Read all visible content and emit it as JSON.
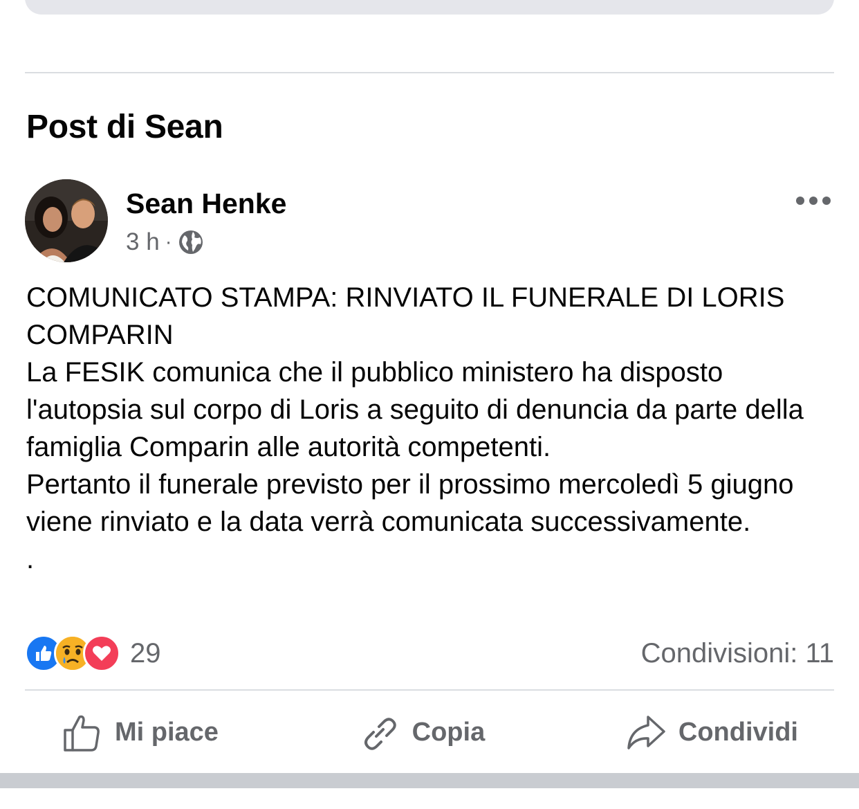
{
  "section": {
    "title": "Post di Sean"
  },
  "post": {
    "author": "Sean Henke",
    "time": "3 h",
    "separator": "·",
    "audience_icon": "globe-icon",
    "more_icon": "more-horizontal-icon",
    "text_lines": [
      "COMUNICATO STAMPA: RINVIATO IL FUNERALE DI LORIS COMPARIN",
      "La FESIK comunica che il pubblico ministero ha disposto l'autopsia sul corpo di Loris a seguito di denuncia da parte della famiglia Comparin alle autorità competenti.",
      "Pertanto il funerale previsto per il prossimo mercoledì 5 giugno viene rinviato e la data verrà comunicata successivamente.",
      "."
    ]
  },
  "engagement": {
    "reactions": [
      {
        "name": "like",
        "icon": "like-reaction-icon",
        "color": "#1877f2"
      },
      {
        "name": "sad",
        "icon": "sad-reaction-icon",
        "color": "#f7b125"
      },
      {
        "name": "love",
        "icon": "love-reaction-icon",
        "color": "#f33e58"
      }
    ],
    "reaction_count": "29",
    "shares_label": "Condivisioni: 11"
  },
  "actions": {
    "like": {
      "label": "Mi piace",
      "icon": "thumbs-up-icon"
    },
    "copy": {
      "label": "Copia",
      "icon": "link-icon"
    },
    "share": {
      "label": "Condividi",
      "icon": "share-arrow-icon"
    }
  },
  "colors": {
    "text": "#050505",
    "secondary": "#65676b",
    "divider": "#dadde1"
  }
}
